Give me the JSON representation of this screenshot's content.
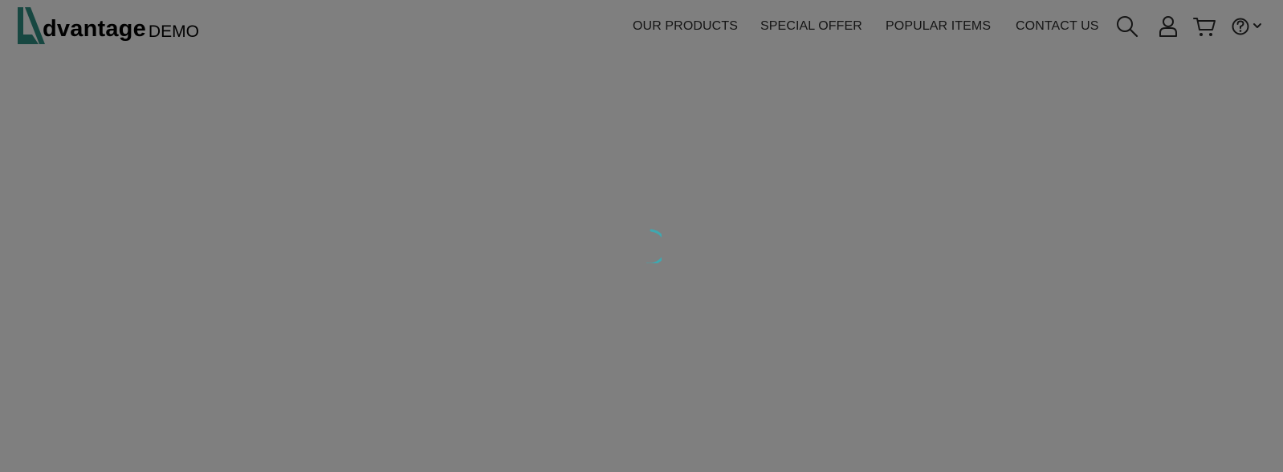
{
  "brand": {
    "name": "dvantage",
    "suffix": "DEMO",
    "accent_color": "#2f8f83"
  },
  "nav": {
    "items": [
      {
        "label": "OUR PRODUCTS"
      },
      {
        "label": "SPECIAL OFFER"
      },
      {
        "label": "POPULAR ITEMS"
      },
      {
        "label": "CONTACT US"
      }
    ]
  },
  "toolbar": {
    "icons": [
      "search-icon",
      "user-icon",
      "cart-icon",
      "help-icon",
      "chevron-down-icon"
    ]
  },
  "overlay": {
    "color": "#000000",
    "opacity": 0.5,
    "spinner_color": "#3fa8b0",
    "state": "loading"
  }
}
